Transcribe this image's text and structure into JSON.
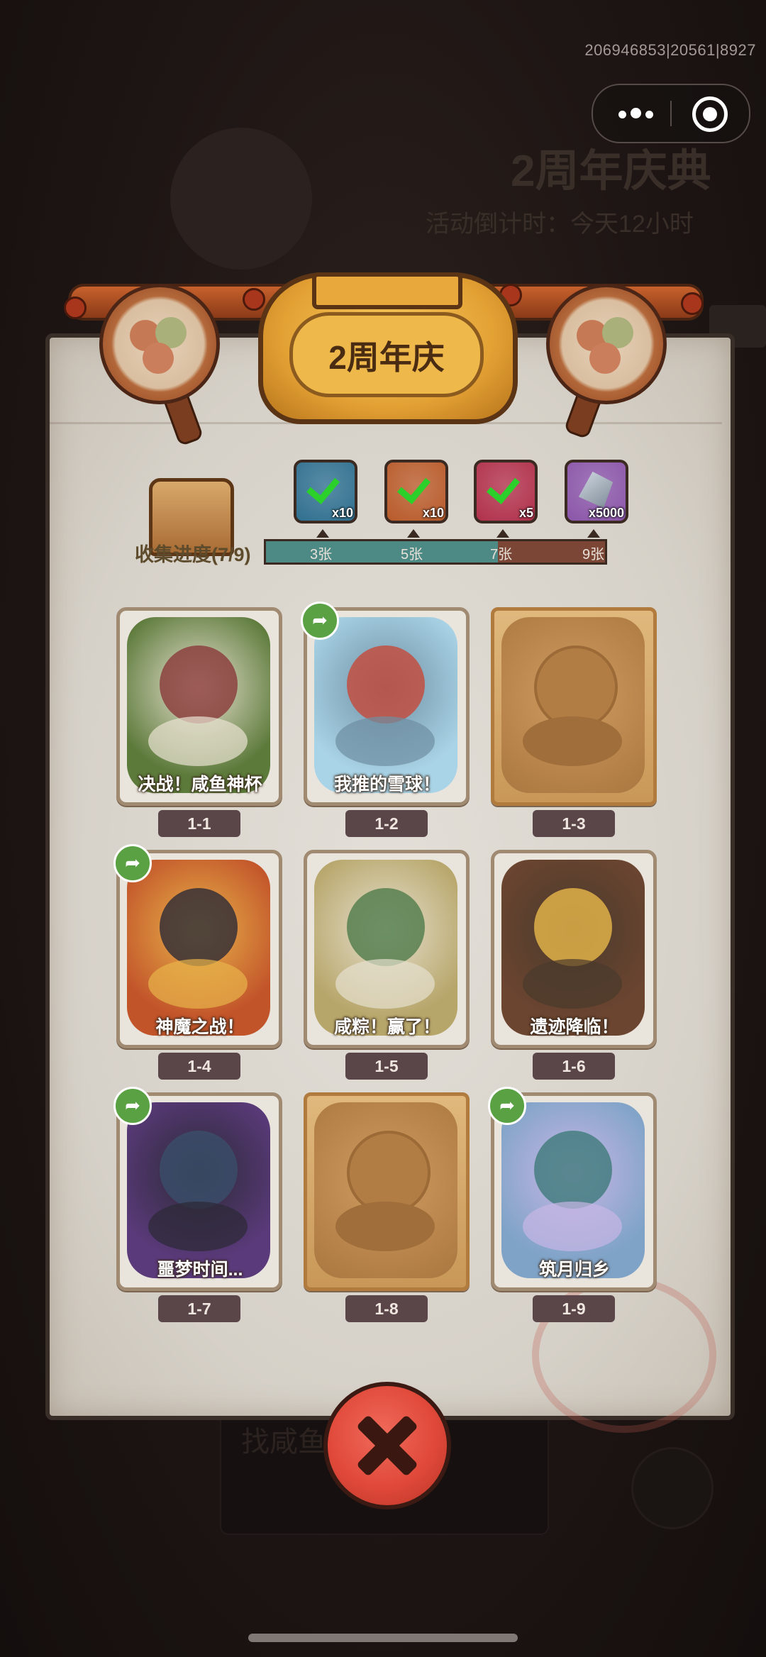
{
  "debug_id": "206946853|20561|8927",
  "background": {
    "title": "2周年庆典",
    "subtitle": "活动倒计时：今天12小时",
    "bottom_text": "找咸鱼拿奖励"
  },
  "panel": {
    "title": "2周年庆",
    "collect_progress": "收集进度(7/9)",
    "collected": 7,
    "total": 9
  },
  "rewards": [
    {
      "qty": "x10",
      "icon": "treasure-chest-icon",
      "claimed": true,
      "color": "#2f6f8f"
    },
    {
      "qty": "x10",
      "icon": "scroll-ticket-icon",
      "claimed": true,
      "color": "#b85a2a"
    },
    {
      "qty": "x5",
      "icon": "purple-orb-icon",
      "claimed": true,
      "color": "#b0304a"
    },
    {
      "qty": "x5000",
      "icon": "silver-crystal-icon",
      "claimed": false,
      "color": "#8a55a8"
    }
  ],
  "milestones": [
    "3张",
    "5张",
    "7张",
    "9张"
  ],
  "cards": [
    {
      "id": "1-1",
      "caption": "决战！咸鱼神杯",
      "collected": true,
      "shared": false,
      "bg": "#5c7a3a",
      "c1": "#8a3a3a",
      "c2": "#e9e2d2"
    },
    {
      "id": "1-2",
      "caption": "我推的雪球！",
      "collected": true,
      "shared": true,
      "bg": "#a9d3e6",
      "c1": "#c64a3a",
      "c2": "#6f8fa3"
    },
    {
      "id": "1-3",
      "caption": "",
      "collected": false,
      "shared": false,
      "bg": "#c99858",
      "c1": "",
      "c2": ""
    },
    {
      "id": "1-4",
      "caption": "神魔之战！",
      "collected": true,
      "shared": true,
      "bg": "#c2542a",
      "c1": "#2c2a36",
      "c2": "#e8b44a"
    },
    {
      "id": "1-5",
      "caption": "咸粽！赢了！",
      "collected": true,
      "shared": false,
      "bg": "#b7a66a",
      "c1": "#4f7a4a",
      "c2": "#e6e0cf"
    },
    {
      "id": "1-6",
      "caption": "遗迹降临！",
      "collected": true,
      "shared": false,
      "bg": "#6b4530",
      "c1": "#e8b84a",
      "c2": "#4a3a2c"
    },
    {
      "id": "1-7",
      "caption": "噩梦时间...",
      "collected": true,
      "shared": true,
      "bg": "#5a3a7a",
      "c1": "#3a4f6a",
      "c2": "#2c2a36"
    },
    {
      "id": "1-8",
      "caption": "",
      "collected": false,
      "shared": false,
      "bg": "#c99858",
      "c1": "",
      "c2": ""
    },
    {
      "id": "1-9",
      "caption": "筑月归乡",
      "collected": true,
      "shared": true,
      "bg": "#7fa3c7",
      "c1": "#3f7a7a",
      "c2": "#c8b7e6"
    }
  ],
  "close_label": "close"
}
